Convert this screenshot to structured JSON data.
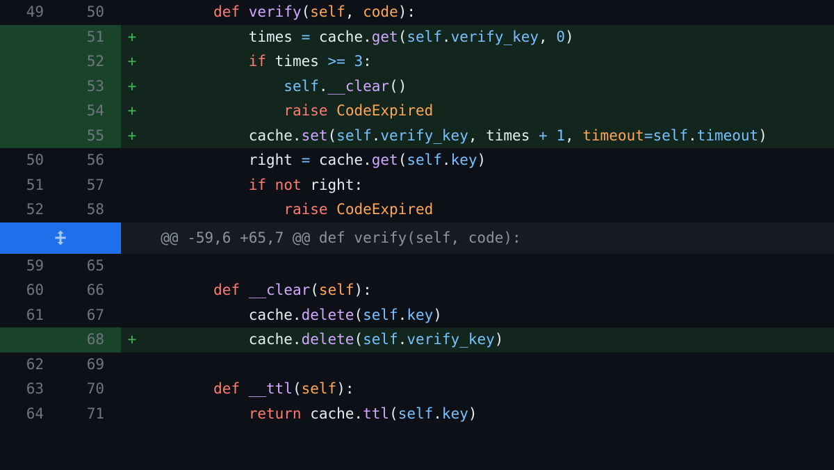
{
  "lines": [
    {
      "type": "ctx",
      "old": "49",
      "new": "50",
      "mark": "",
      "tokens": [
        {
          "c": "id",
          "t": "        "
        },
        {
          "c": "kw",
          "t": "def"
        },
        {
          "c": "id",
          "t": " "
        },
        {
          "c": "fn",
          "t": "verify"
        },
        {
          "c": "id",
          "t": "("
        },
        {
          "c": "am",
          "t": "self"
        },
        {
          "c": "id",
          "t": ", "
        },
        {
          "c": "am",
          "t": "code"
        },
        {
          "c": "id",
          "t": "):"
        }
      ]
    },
    {
      "type": "add",
      "old": "",
      "new": "51",
      "mark": "+",
      "tokens": [
        {
          "c": "id",
          "t": "            times "
        },
        {
          "c": "op",
          "t": "="
        },
        {
          "c": "id",
          "t": " cache."
        },
        {
          "c": "fn",
          "t": "get"
        },
        {
          "c": "id",
          "t": "("
        },
        {
          "c": "at",
          "t": "self"
        },
        {
          "c": "id",
          "t": "."
        },
        {
          "c": "at",
          "t": "verify_key"
        },
        {
          "c": "id",
          "t": ", "
        },
        {
          "c": "op",
          "t": "0"
        },
        {
          "c": "id",
          "t": ")"
        }
      ]
    },
    {
      "type": "add",
      "old": "",
      "new": "52",
      "mark": "+",
      "tokens": [
        {
          "c": "id",
          "t": "            "
        },
        {
          "c": "kw",
          "t": "if"
        },
        {
          "c": "id",
          "t": " times "
        },
        {
          "c": "op",
          "t": ">="
        },
        {
          "c": "id",
          "t": " "
        },
        {
          "c": "op",
          "t": "3"
        },
        {
          "c": "id",
          "t": ":"
        }
      ]
    },
    {
      "type": "add",
      "old": "",
      "new": "53",
      "mark": "+",
      "tokens": [
        {
          "c": "id",
          "t": "                "
        },
        {
          "c": "at",
          "t": "self"
        },
        {
          "c": "id",
          "t": "."
        },
        {
          "c": "fn",
          "t": "__clear"
        },
        {
          "c": "id",
          "t": "()"
        }
      ]
    },
    {
      "type": "add",
      "old": "",
      "new": "54",
      "mark": "+",
      "tokens": [
        {
          "c": "id",
          "t": "                "
        },
        {
          "c": "kw",
          "t": "raise"
        },
        {
          "c": "id",
          "t": " "
        },
        {
          "c": "cl",
          "t": "CodeExpired"
        }
      ]
    },
    {
      "type": "add",
      "old": "",
      "new": "55",
      "mark": "+",
      "tokens": [
        {
          "c": "id",
          "t": "            cache."
        },
        {
          "c": "fn",
          "t": "set"
        },
        {
          "c": "id",
          "t": "("
        },
        {
          "c": "at",
          "t": "self"
        },
        {
          "c": "id",
          "t": "."
        },
        {
          "c": "at",
          "t": "verify_key"
        },
        {
          "c": "id",
          "t": ", times "
        },
        {
          "c": "op",
          "t": "+"
        },
        {
          "c": "id",
          "t": " "
        },
        {
          "c": "op",
          "t": "1"
        },
        {
          "c": "id",
          "t": ", "
        },
        {
          "c": "am",
          "t": "timeout"
        },
        {
          "c": "op",
          "t": "="
        },
        {
          "c": "at",
          "t": "self"
        },
        {
          "c": "id",
          "t": "."
        },
        {
          "c": "at",
          "t": "timeout"
        },
        {
          "c": "id",
          "t": ")"
        }
      ]
    },
    {
      "type": "ctx",
      "old": "50",
      "new": "56",
      "mark": "",
      "tokens": [
        {
          "c": "id",
          "t": "            right "
        },
        {
          "c": "op",
          "t": "="
        },
        {
          "c": "id",
          "t": " cache."
        },
        {
          "c": "fn",
          "t": "get"
        },
        {
          "c": "id",
          "t": "("
        },
        {
          "c": "at",
          "t": "self"
        },
        {
          "c": "id",
          "t": "."
        },
        {
          "c": "at",
          "t": "key"
        },
        {
          "c": "id",
          "t": ")"
        }
      ]
    },
    {
      "type": "ctx",
      "old": "51",
      "new": "57",
      "mark": "",
      "tokens": [
        {
          "c": "id",
          "t": "            "
        },
        {
          "c": "kw",
          "t": "if"
        },
        {
          "c": "id",
          "t": " "
        },
        {
          "c": "kw",
          "t": "not"
        },
        {
          "c": "id",
          "t": " right:"
        }
      ]
    },
    {
      "type": "ctx",
      "old": "52",
      "new": "58",
      "mark": "",
      "tokens": [
        {
          "c": "id",
          "t": "                "
        },
        {
          "c": "kw",
          "t": "raise"
        },
        {
          "c": "id",
          "t": " "
        },
        {
          "c": "cl",
          "t": "CodeExpired"
        }
      ]
    },
    {
      "type": "hunk",
      "old": "",
      "new": "",
      "mark": "",
      "text": "  @@ -59,6 +65,7 @@ def verify(self, code):"
    },
    {
      "type": "ctx",
      "old": "59",
      "new": "65",
      "mark": "",
      "tokens": [
        {
          "c": "id",
          "t": ""
        }
      ]
    },
    {
      "type": "ctx",
      "old": "60",
      "new": "66",
      "mark": "",
      "tokens": [
        {
          "c": "id",
          "t": "        "
        },
        {
          "c": "kw",
          "t": "def"
        },
        {
          "c": "id",
          "t": " "
        },
        {
          "c": "fn",
          "t": "__clear"
        },
        {
          "c": "id",
          "t": "("
        },
        {
          "c": "am",
          "t": "self"
        },
        {
          "c": "id",
          "t": "):"
        }
      ]
    },
    {
      "type": "ctx",
      "old": "61",
      "new": "67",
      "mark": "",
      "tokens": [
        {
          "c": "id",
          "t": "            cache."
        },
        {
          "c": "fn",
          "t": "delete"
        },
        {
          "c": "id",
          "t": "("
        },
        {
          "c": "at",
          "t": "self"
        },
        {
          "c": "id",
          "t": "."
        },
        {
          "c": "at",
          "t": "key"
        },
        {
          "c": "id",
          "t": ")"
        }
      ]
    },
    {
      "type": "add",
      "old": "",
      "new": "68",
      "mark": "+",
      "tokens": [
        {
          "c": "id",
          "t": "            cache."
        },
        {
          "c": "fn",
          "t": "delete"
        },
        {
          "c": "id",
          "t": "("
        },
        {
          "c": "at",
          "t": "self"
        },
        {
          "c": "id",
          "t": "."
        },
        {
          "c": "at",
          "t": "verify_key"
        },
        {
          "c": "id",
          "t": ")"
        }
      ]
    },
    {
      "type": "ctx",
      "old": "62",
      "new": "69",
      "mark": "",
      "tokens": [
        {
          "c": "id",
          "t": ""
        }
      ]
    },
    {
      "type": "ctx",
      "old": "63",
      "new": "70",
      "mark": "",
      "tokens": [
        {
          "c": "id",
          "t": "        "
        },
        {
          "c": "kw",
          "t": "def"
        },
        {
          "c": "id",
          "t": " "
        },
        {
          "c": "fn",
          "t": "__ttl"
        },
        {
          "c": "id",
          "t": "("
        },
        {
          "c": "am",
          "t": "self"
        },
        {
          "c": "id",
          "t": "):"
        }
      ]
    },
    {
      "type": "ctx",
      "old": "64",
      "new": "71",
      "mark": "",
      "tokens": [
        {
          "c": "id",
          "t": "            "
        },
        {
          "c": "kw",
          "t": "return"
        },
        {
          "c": "id",
          "t": " cache."
        },
        {
          "c": "fn",
          "t": "ttl"
        },
        {
          "c": "id",
          "t": "("
        },
        {
          "c": "at",
          "t": "self"
        },
        {
          "c": "id",
          "t": "."
        },
        {
          "c": "at",
          "t": "key"
        },
        {
          "c": "id",
          "t": ")"
        }
      ]
    }
  ]
}
